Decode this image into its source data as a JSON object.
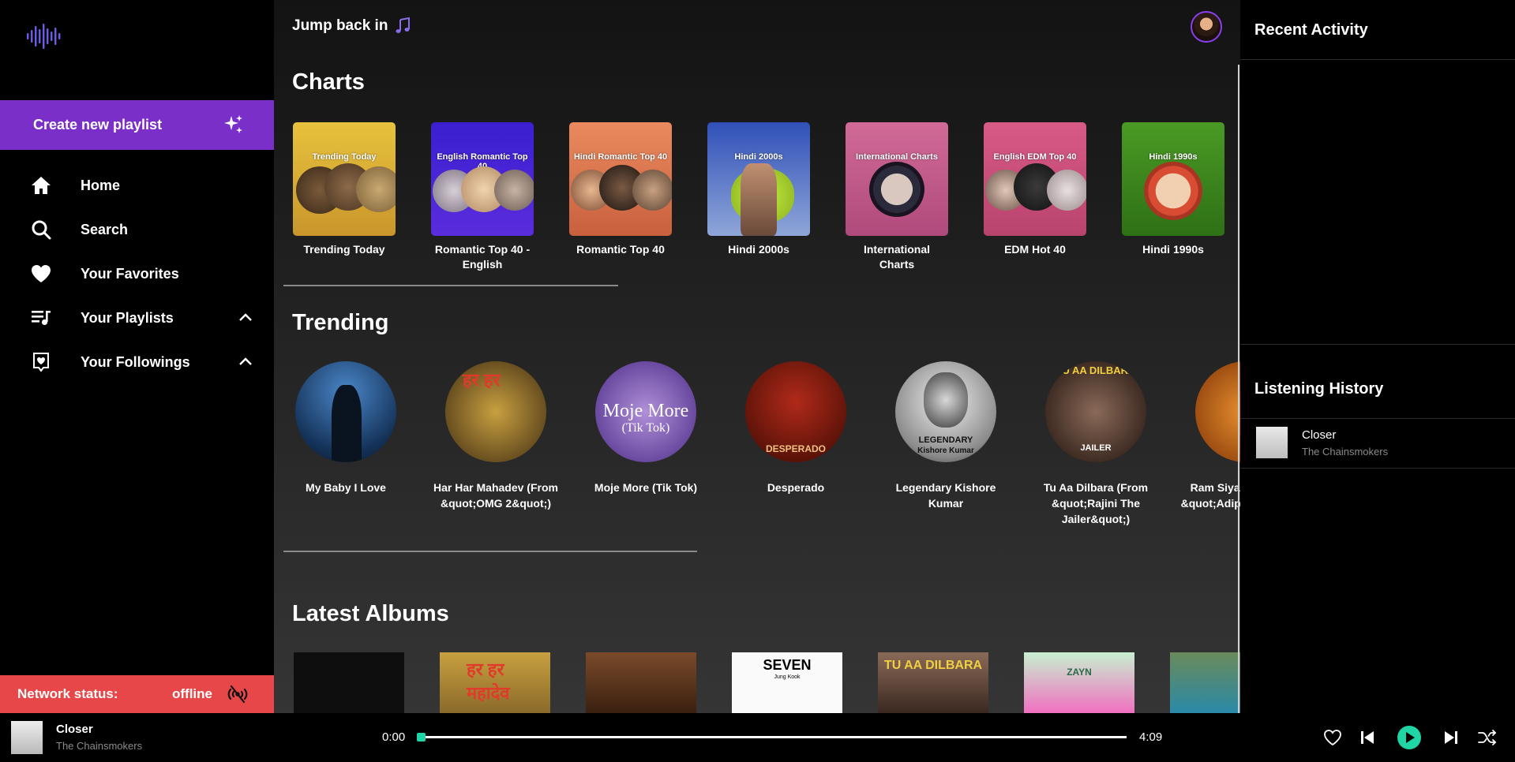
{
  "sidebar": {
    "create_label": "Create new playlist",
    "nav": [
      {
        "label": "Home",
        "icon": "home-icon"
      },
      {
        "label": "Search",
        "icon": "search-icon"
      },
      {
        "label": "Your Favorites",
        "icon": "heart-icon"
      },
      {
        "label": "Your Playlists",
        "icon": "playlist-icon"
      },
      {
        "label": "Your Followings",
        "icon": "following-icon"
      }
    ],
    "network_label": "Network status:",
    "network_value": "offline"
  },
  "main": {
    "jump_back": "Jump back in",
    "charts_title": "Charts",
    "charts": [
      {
        "tag": "Trending Today",
        "caption": "Trending Today",
        "color": "#d3a830"
      },
      {
        "tag": "English Romantic Top 40",
        "caption": "Romantic Top 40 - English",
        "color": "#3a1fd0"
      },
      {
        "tag": "Hindi Romantic Top 40",
        "caption": "Romantic Top 40",
        "color": "#e07a58"
      },
      {
        "tag": "Hindi 2000s",
        "caption": "Hindi 2000s",
        "color": "#5d7fc9"
      },
      {
        "tag": "International Charts",
        "caption": "International Charts",
        "color": "#c25a8a"
      },
      {
        "tag": "English EDM Top 40",
        "caption": "EDM Hot 40",
        "color": "#c04a74"
      },
      {
        "tag": "Hindi 1990s",
        "caption": "Hindi 1990s",
        "color": "#3e8a1e"
      }
    ],
    "trending_title": "Trending",
    "trending": [
      {
        "caption": "My Baby I Love"
      },
      {
        "caption": "Har Har Mahadev (From &quot;OMG 2&quot;)"
      },
      {
        "caption": "Moje More (Tik Tok)",
        "art_text": "Moje More",
        "art_sub": "(Tik Tok)"
      },
      {
        "caption": "Desperado",
        "art_text": "DESPERADO"
      },
      {
        "caption": "Legendary Kishore Kumar",
        "art_text": "LEGENDARY",
        "art_sub": "Kishore Kumar"
      },
      {
        "caption": "Tu Aa Dilbara (From &quot;Rajini The Jailer&quot;)",
        "art_text": "TU AA DILBARA",
        "art_sub": "JAILER"
      },
      {
        "caption": "Ram Siya Ram (From &quot;Adipurush&quot;)"
      }
    ],
    "albums_title": "Latest Albums",
    "albums": [
      {
        "art_text": ""
      },
      {
        "art_text": "हर हर महादेव"
      },
      {
        "art_text": ""
      },
      {
        "art_text": "SEVEN",
        "art_sub": "Jung Kook"
      },
      {
        "art_text": "TU AA DILBARA"
      },
      {
        "art_text": "ZAYN"
      },
      {
        "art_text": ""
      }
    ]
  },
  "right": {
    "recent_title": "Recent Activity",
    "history_title": "Listening History",
    "history": [
      {
        "title": "Closer",
        "artist": "The Chainsmokers"
      }
    ]
  },
  "player": {
    "title": "Closer",
    "artist": "The Chainsmokers",
    "current_time": "0:00",
    "duration": "4:09",
    "progress": 0,
    "accent": "#1fd5a6"
  }
}
